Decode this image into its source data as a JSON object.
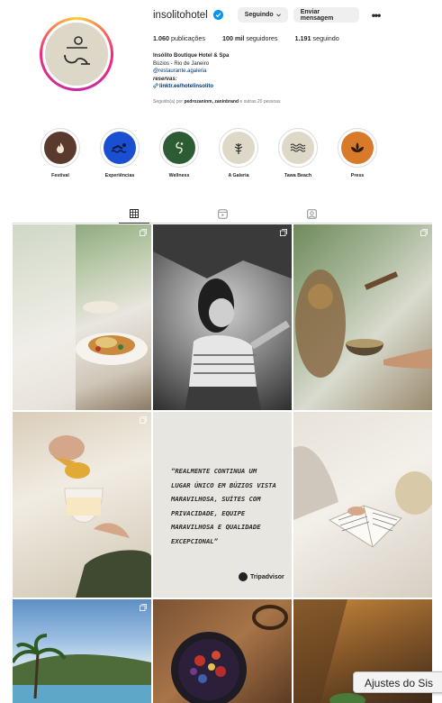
{
  "profile": {
    "username": "insolitohotel",
    "following_btn": "Seguindo",
    "message_btn": "Enviar mensagem",
    "more": "•••"
  },
  "stats": {
    "posts_count": "1.060",
    "posts_label": "publicações",
    "followers_count": "100 mil",
    "followers_label": "seguidores",
    "following_count": "1.191",
    "following_label": "seguindo"
  },
  "bio": {
    "name": "Insólito Boutique Hotel & Spa",
    "location": "Búzios - Rio de Janeiro",
    "handle": "@restaurante.agaleria",
    "reserve": "reservas:",
    "link": "linktr.ee/hotelinsolito",
    "followed_prefix": "Seguido(a) por",
    "followed_names": "pedrozaninm, zaninbrand",
    "followed_suffix": "e outras 20 pessoas"
  },
  "highlights": [
    {
      "label": "Festival",
      "color": "#5b3a2e",
      "icon": "flame-icon"
    },
    {
      "label": "Experiências",
      "color": "#1b4fd1",
      "icon": "swimmer-icon"
    },
    {
      "label": "Wellness",
      "color": "#2d5c34",
      "icon": "lotus-icon"
    },
    {
      "label": "A Galeria",
      "color": "#ddd8c7",
      "icon": "plant-icon"
    },
    {
      "label": "Tawa Beach",
      "color": "#ddd8c7",
      "icon": "waves-icon"
    },
    {
      "label": "Press",
      "color": "#d97a2a",
      "icon": "flower-icon"
    }
  ],
  "tabs": [
    "posts-tab",
    "reels-tab",
    "tagged-tab"
  ],
  "quote_post": {
    "text": "“REALMENTE CONTINUA UM LUGAR ÚNICO EM BÚZIOS VISTA MARAVILHOSA, SUÍTES COM PRIVACIDADE, EQUIPE MARAVILHOSA E QUALIDADE EXCEPCIONAL”",
    "brand": "Tripadvisor"
  },
  "tooltip": "Ajustes do Sis"
}
